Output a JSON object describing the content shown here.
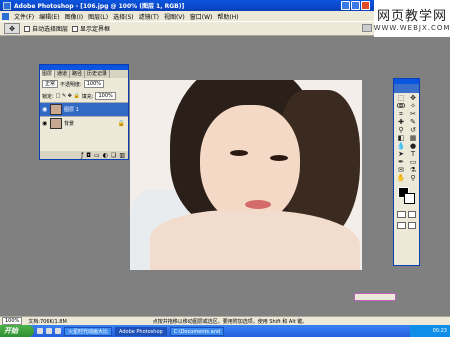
{
  "window": {
    "title": "Adobe Photoshop - [106.jpg @ 100% (图层 1, RGB)]"
  },
  "watermark": {
    "line1": "网页教学网",
    "line2": "WWW.WEBJX.COM"
  },
  "menubar": {
    "items": [
      "文件(F)",
      "编辑(E)",
      "图像(I)",
      "图层(L)",
      "选择(S)",
      "滤镜(T)",
      "视图(V)",
      "窗口(W)",
      "帮助(H)"
    ]
  },
  "options": {
    "auto_select": "自动选择图层",
    "show_bounds": "显示定界框"
  },
  "layers_panel": {
    "tabs": [
      "图层",
      "通道",
      "路径",
      "历史记录"
    ],
    "blend_mode": "正常",
    "opacity_label": "不透明度:",
    "opacity_value": "100%",
    "lock_label": "锁定:",
    "fill_label": "填充:",
    "fill_value": "100%",
    "layers": [
      {
        "name": "图层 1",
        "selected": true
      },
      {
        "name": "背景",
        "selected": false
      }
    ]
  },
  "status": {
    "zoom": "100%",
    "doc_info": "文档:706K/1.8M",
    "hint": "点按并拖移以移动图层或选区。要用附加选项，使用 Shift 和 Alt 键。"
  },
  "taskbar": {
    "start": "开始",
    "tasks": [
      "火星时代动画大比",
      "Adobe Photoshop",
      "C:\\Documents and"
    ],
    "clock": "00:23"
  },
  "colors": {
    "titlebar": "#0a55e0",
    "workspace": "#808080",
    "panel": "#ece9d8",
    "selected_layer": "#316ac5"
  }
}
